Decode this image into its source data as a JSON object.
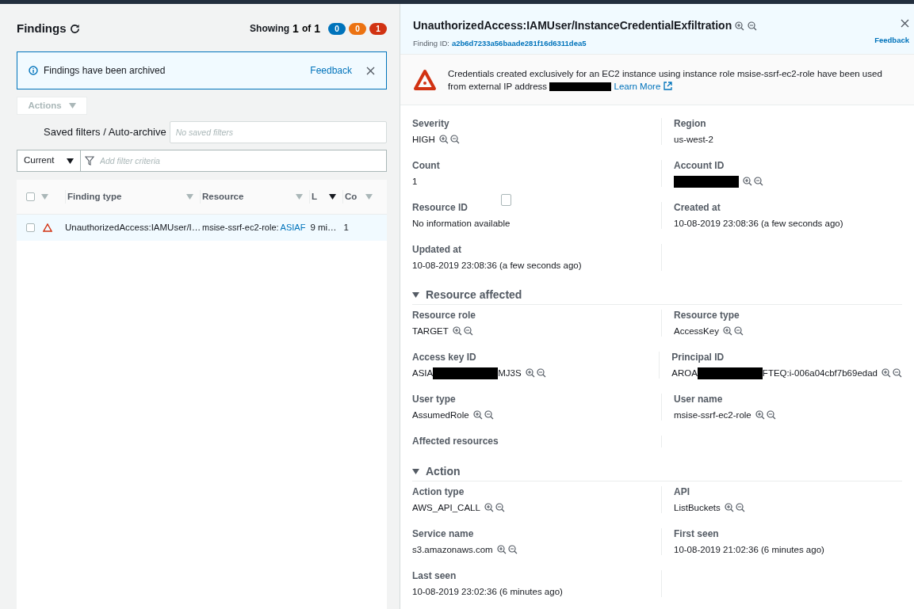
{
  "findings_panel": {
    "title": "Findings",
    "showing_label": "Showing",
    "showing_current": "1",
    "of_label": "of",
    "showing_total": "1",
    "counts": [
      {
        "value": "0",
        "color": "#0073bb"
      },
      {
        "value": "0",
        "color": "#ec7211"
      },
      {
        "value": "1",
        "color": "#d13212"
      }
    ],
    "notice": {
      "text": "Findings have been archived",
      "link": "Feedback"
    },
    "actions_button": {
      "label": "Actions",
      "disabled": true
    },
    "saved_filters": {
      "label": "Saved filters / Auto-archive",
      "placeholder": "No saved filters"
    },
    "scope_select": {
      "value": "Current"
    },
    "filter_field": {
      "placeholder": "Add filter criteria"
    },
    "table": {
      "select_all_checked": false,
      "columns": [
        {
          "label": "Finding type",
          "sorted": false
        },
        {
          "label": "Resource",
          "sorted": false
        },
        {
          "label": "L",
          "sorted": true
        },
        {
          "label": "Co",
          "sorted": false
        }
      ],
      "rows": [
        {
          "selected": true,
          "checked": false,
          "finding_type": "UnauthorizedAccess:IAMUser/I…",
          "resource": "msise-ssrf-ec2-role: ",
          "resource_link": "ASIAF",
          "last_seen": "9 mi…",
          "count": "1"
        }
      ]
    }
  },
  "detail_panel": {
    "title": "UnauthorizedAccess:IAMUser/InstanceCredentialExfiltration",
    "finding_id_label": "Finding ID:",
    "finding_id": "a2b6d7233a56baade281f16d6311dea5",
    "feedback": "Feedback",
    "alert": {
      "text_before": "Credentials created exclusively for an EC2 instance using instance role msise-ssrf-ec2-role have been used from external IP address",
      "link": "Learn More"
    },
    "stray_checkbox": {
      "checked": false
    },
    "sections": [
      {
        "rows": [
          [
            {
              "label": "Severity",
              "value": [
                {
                  "kind": "text",
                  "text": "HIGH"
                }
              ],
              "filterable": true
            },
            {
              "label": "Region",
              "value": [
                {
                  "kind": "text",
                  "text": "us-west-2"
                }
              ],
              "filterable": false
            }
          ],
          [
            {
              "label": "Count",
              "value": [
                {
                  "kind": "text",
                  "text": "1"
                }
              ],
              "filterable": false
            },
            {
              "label": "Account ID",
              "value": [
                {
                  "kind": "redacted"
                }
              ],
              "filterable": true
            }
          ],
          [
            {
              "label": "Resource ID",
              "value": [
                {
                  "kind": "text",
                  "text": "No information available"
                }
              ],
              "filterable": false
            },
            {
              "label": "Created at",
              "value": [
                {
                  "kind": "text",
                  "text": "10-08-2019 23:08:36 (a few seconds ago)"
                }
              ],
              "filterable": false
            }
          ],
          [
            {
              "label": "Updated at",
              "value": [
                {
                  "kind": "text",
                  "text": "10-08-2019 23:08:36 (a few seconds ago)"
                }
              ],
              "filterable": false
            },
            null
          ]
        ]
      },
      {
        "title": "Resource affected",
        "expanded": true,
        "rows": [
          [
            {
              "label": "Resource role",
              "value": [
                {
                  "kind": "text",
                  "text": "TARGET"
                }
              ],
              "filterable": true
            },
            {
              "label": "Resource type",
              "value": [
                {
                  "kind": "text",
                  "text": "AccessKey"
                }
              ],
              "filterable": true
            }
          ],
          [
            {
              "label": "Access key ID",
              "value": [
                {
                  "kind": "text",
                  "text": "ASIA"
                },
                {
                  "kind": "redacted"
                },
                {
                  "kind": "text",
                  "text": "MJ3S"
                }
              ],
              "filterable": true
            },
            {
              "label": "Principal ID",
              "value": [
                {
                  "kind": "text",
                  "text": "AROA"
                },
                {
                  "kind": "redacted"
                },
                {
                  "kind": "text",
                  "text": "FTEQ:i-006a04cbf7b69edad"
                }
              ],
              "filterable": true
            }
          ],
          [
            {
              "label": "User type",
              "value": [
                {
                  "kind": "text",
                  "text": "AssumedRole"
                }
              ],
              "filterable": true
            },
            {
              "label": "User name",
              "value": [
                {
                  "kind": "text",
                  "text": "msise-ssrf-ec2-role"
                }
              ],
              "filterable": true
            }
          ],
          [
            {
              "label": "Affected resources",
              "filterable": false
            },
            null
          ]
        ]
      },
      {
        "title": "Action",
        "expanded": true,
        "rows": [
          [
            {
              "label": "Action type",
              "value": [
                {
                  "kind": "text",
                  "text": "AWS_API_CALL"
                }
              ],
              "filterable": true
            },
            {
              "label": "API",
              "value": [
                {
                  "kind": "text",
                  "text": "ListBuckets"
                }
              ],
              "filterable": true
            }
          ],
          [
            {
              "label": "Service name",
              "value": [
                {
                  "kind": "text",
                  "text": "s3.amazonaws.com"
                }
              ],
              "filterable": true
            },
            {
              "label": "First seen",
              "value": [
                {
                  "kind": "text",
                  "text": "10-08-2019 21:02:36 (6 minutes ago)"
                }
              ],
              "filterable": false
            }
          ],
          [
            {
              "label": "Last seen",
              "value": [
                {
                  "kind": "text",
                  "text": "10-08-2019 23:02:36 (6 minutes ago)"
                }
              ],
              "filterable": false
            },
            null
          ]
        ]
      }
    ]
  }
}
